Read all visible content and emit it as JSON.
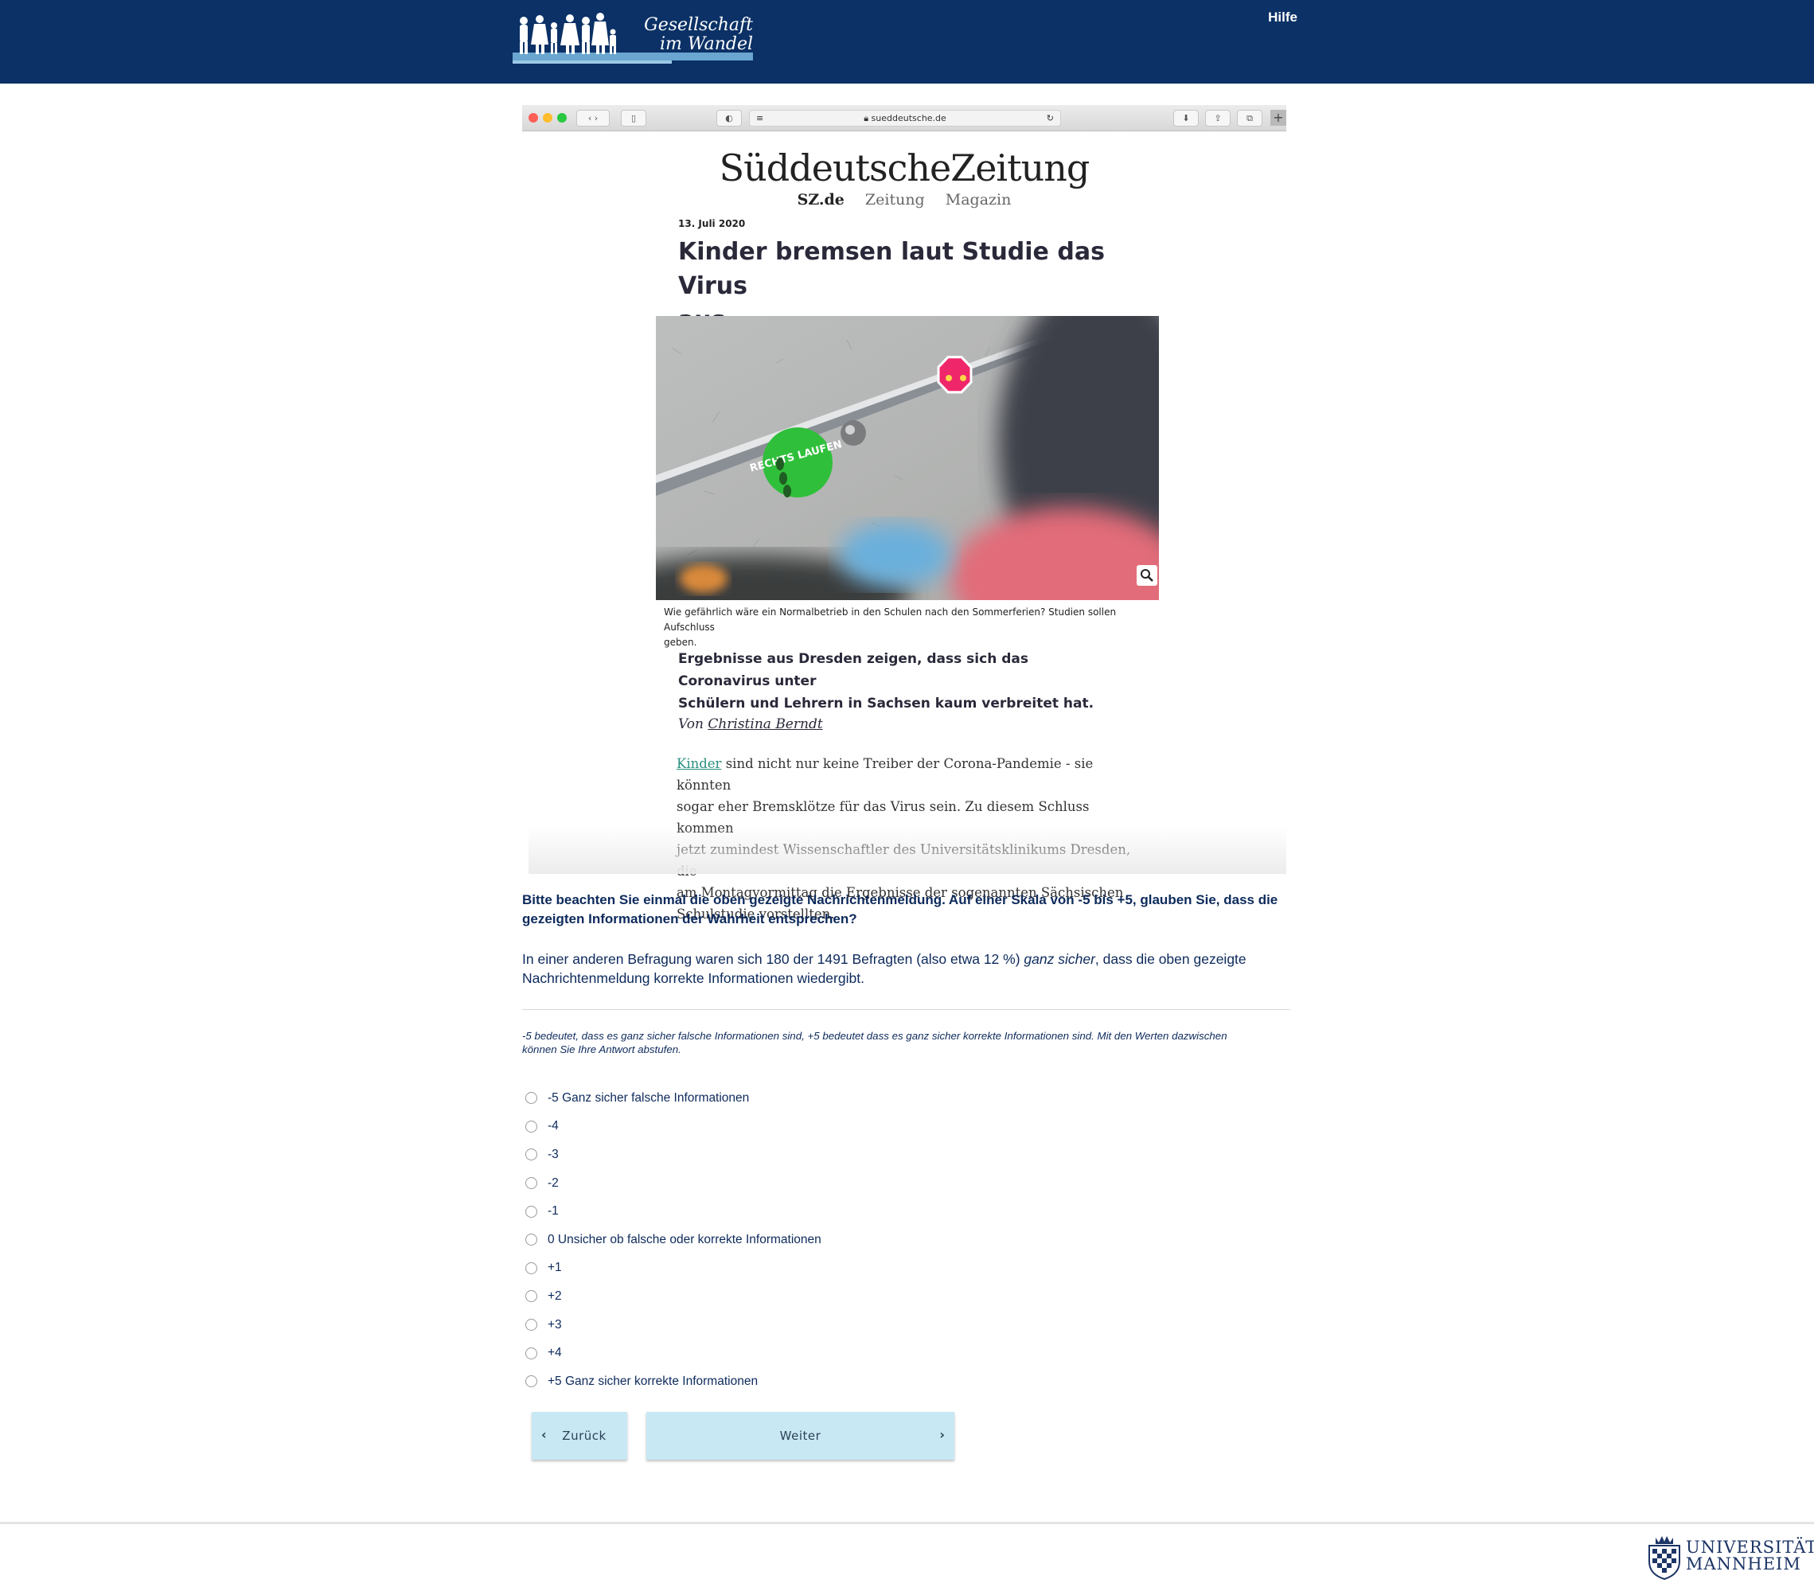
{
  "header": {
    "logo_line1": "Gesellschaft",
    "logo_line2": "im Wandel",
    "help_label": "Hilfe"
  },
  "browser": {
    "url": "sueddeutsche.de"
  },
  "article": {
    "masthead": "SüddeutscheZeitung",
    "nav": [
      "SZ.de",
      "Zeitung",
      "Magazin"
    ],
    "date": "13. Juli 2020",
    "headline_line1": "Kinder bremsen laut Studie das Virus",
    "headline_line2": "aus",
    "sign_text": "RECHTS LAUFEN",
    "caption_line1": "Wie gefährlich wäre ein Normalbetrieb in den Schulen nach den Sommerferien? Studien sollen Aufschluss",
    "caption_line2": "geben.",
    "lead_line1": "Ergebnisse aus Dresden zeigen, dass sich das Coronavirus unter",
    "lead_line2": "Schülern und Lehrern in Sachsen kaum verbreitet hat.",
    "byline_prefix": "Von",
    "author": "Christina Berndt",
    "body_link": "Kinder",
    "body_line1_rest": "sind nicht nur keine Treiber der Corona-Pandemie - sie könnten",
    "body_line2": "sogar eher Bremsklötze für das Virus sein. Zu diesem Schluss kommen",
    "body_line3": "jetzt zumindest Wissenschaftler des Universitätsklinikums Dresden, die",
    "body_line4": "am Montagvormittag die Ergebnisse der sogenannten Sächsischen",
    "body_line5": "Schulstudie vorstellten."
  },
  "survey": {
    "question_line1": "Bitte beachten Sie einmal die oben gezeigte Nachrichtenmeldung. Auf einer Skala von -5 bis +5, glauben Sie, dass die",
    "question_line2": "gezeigten Informationen der Wahrheit entsprechen?",
    "info_line1_a": "In einer anderen Befragung waren sich 180 der 1491 Befragten (also etwa 12 %)",
    "info_line1_em": "ganz sicher",
    "info_line1_b": ", dass die oben gezeigte",
    "info_line2": "Nachrichtenmeldung korrekte Informationen wiedergibt.",
    "hint_line1": "-5 bedeutet, dass es ganz sicher falsche Informationen sind, +5 bedeutet dass es ganz sicher korrekte Informationen sind. Mit den Werten dazwischen",
    "hint_line2": "können Sie Ihre Antwort abstufen.",
    "options": [
      "-5 Ganz sicher falsche Informationen",
      "-4",
      "-3",
      "-2",
      "-1",
      "0 Unsicher ob falsche oder korrekte Informationen",
      "+1",
      "+2",
      "+3",
      "+4",
      "+5 Ganz sicher korrekte Informationen"
    ],
    "back_label": "Zurück",
    "next_label": "Weiter"
  },
  "footer": {
    "university_line1": "UNIVERSITÄT",
    "university_line2": "MANNHEIM"
  },
  "colors": {
    "header_bg": "#0b3166",
    "text": "#0d2a5c",
    "button_bg": "#c8e8f4",
    "link": "#29907f"
  }
}
